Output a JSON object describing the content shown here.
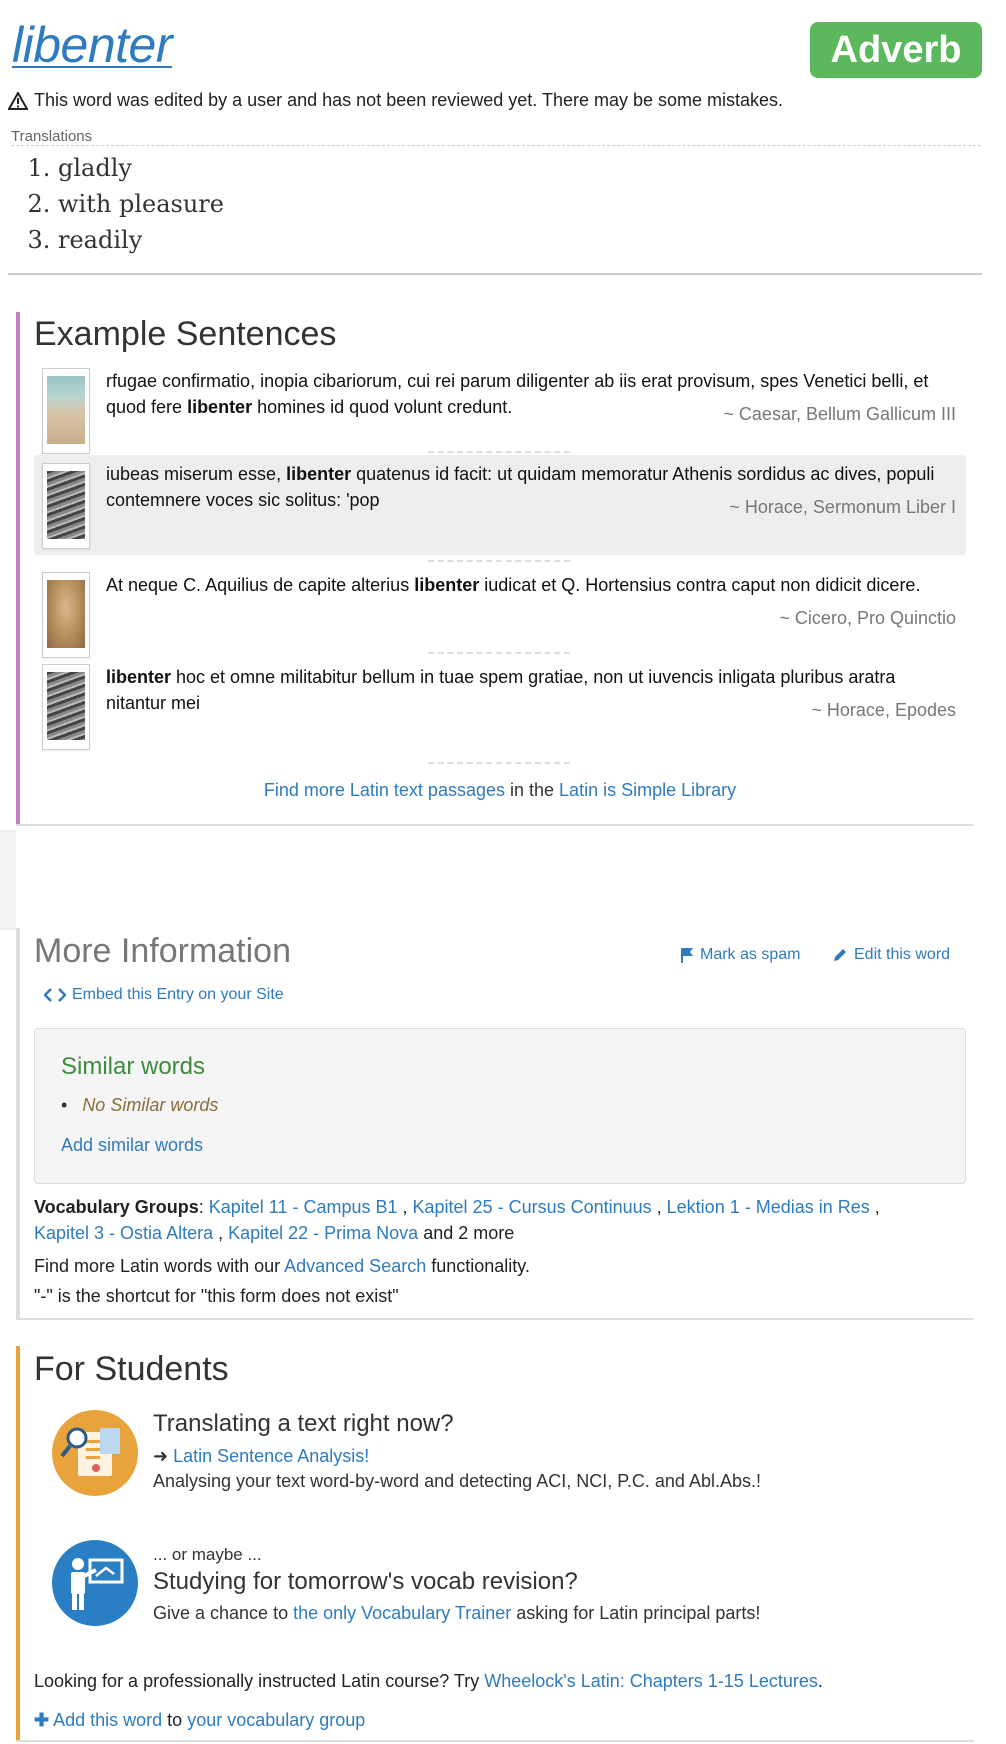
{
  "header": {
    "word": "libenter",
    "part_of_speech": "Adverb",
    "warning": "This word was edited by a user and has not been reviewed yet. There may be some mistakes."
  },
  "translations": {
    "label": "Translations",
    "items": [
      "gladly",
      "with pleasure",
      "readily"
    ]
  },
  "examples": {
    "title": "Example Sentences",
    "rows": [
      {
        "pre": "rfugae confirmatio, inopia cibariorum, cui rei parum diligenter ab iis erat provisum, spes Venetici belli, et quod fere ",
        "bold": "libenter",
        "post": " homines id quod volunt credunt.",
        "source": "~ Caesar, Bellum Gallicum III"
      },
      {
        "pre": "iubeas miserum esse, ",
        "bold": "libenter",
        "post": " quatenus id facit: ut quidam memoratur Athenis sordidus ac dives, populi contemnere voces sic solitus: 'pop",
        "source": "~ Horace, Sermonum Liber I"
      },
      {
        "pre": "At neque C. Aquilius de capite alterius ",
        "bold": "libenter",
        "post": " iudicat et Q. Hortensius contra caput non didicit dicere.",
        "source": "~ Cicero, Pro Quinctio"
      },
      {
        "pre": "",
        "bold": "libenter",
        "post": " hoc et omne militabitur bellum in tuae spem gratiae, non ut iuvencis inligata pluribus aratra nitantur mei",
        "source": "~ Horace, Epodes"
      }
    ],
    "more_link": "Find more Latin text passages",
    "more_mid": " in the ",
    "library_link": "Latin is Simple Library"
  },
  "more_info": {
    "title": "More Information",
    "mark_spam": "Mark as spam",
    "edit_word": "Edit this word",
    "embed": "Embed this Entry on your Site",
    "similar_title": "Similar words",
    "similar_none": "No Similar words",
    "similar_add": "Add similar words",
    "vocab_label": "Vocabulary Groups",
    "vocab_groups": [
      "Kapitel 11 - Campus B1",
      "Kapitel 25 - Cursus Continuus",
      "Lektion 1 - Medias in Res",
      "Kapitel 3 - Ostia Altera",
      "Kapitel 22 - Prima Nova"
    ],
    "vocab_more": " and 2 more",
    "find_pre": "Find more Latin words with our ",
    "find_link": "Advanced Search",
    "find_post": " functionality.",
    "shortcut": "\"-\" is the shortcut for \"this form does not exist\""
  },
  "students": {
    "title": "For Students",
    "card1_title": "Translating a text right now?",
    "card1_link": "Latin Sentence Analysis!",
    "card1_text": "Analysing your text word-by-word and detecting ACI, NCI, P.C. and Abl.Abs.!",
    "card2_pre": "... or maybe ...",
    "card2_title": "Studying for tomorrow's vocab revision?",
    "card2_text_pre": "Give a chance to ",
    "card2_link": "the only Vocabulary Trainer",
    "card2_text_post": " asking for Latin principal parts!",
    "course_pre": "Looking for a professionally instructed Latin course? Try ",
    "course_link": "Wheelock's Latin: Chapters 1-15 Lectures",
    "course_post": ".",
    "add_word_link": "Add this word",
    "add_word_mid": " to ",
    "add_group_link": "your vocabulary group"
  },
  "colors": {
    "link": "#2e7bbf",
    "badge": "#5cb85c",
    "examples_bar": "#c77dc7",
    "students_bar": "#e8a33d",
    "similar_title": "#3d8b3d"
  }
}
